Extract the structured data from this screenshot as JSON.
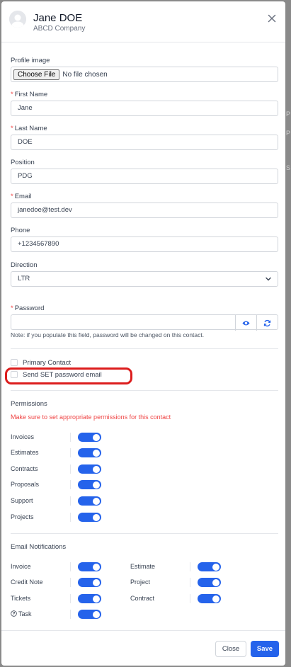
{
  "background_peek": [
    "P",
    "P",
    "S"
  ],
  "header": {
    "name": "Jane DOE",
    "company": "ABCD Company"
  },
  "form": {
    "profile_image": {
      "label": "Profile image",
      "button": "Choose File",
      "status": "No file chosen"
    },
    "first_name": {
      "label": "First Name",
      "value": "Jane",
      "required_mark": "*"
    },
    "last_name": {
      "label": "Last Name",
      "value": "DOE",
      "required_mark": "*"
    },
    "position": {
      "label": "Position",
      "value": "PDG"
    },
    "email": {
      "label": "Email",
      "value": "janedoe@test.dev",
      "required_mark": "*"
    },
    "phone": {
      "label": "Phone",
      "value": "+1234567890"
    },
    "direction": {
      "label": "Direction",
      "value": "LTR"
    },
    "password": {
      "label": "Password",
      "value": "",
      "required_mark": "*",
      "note": "Note: if you populate this field, password will be changed on this contact."
    },
    "primary_contact": {
      "label": "Primary Contact",
      "checked": false
    },
    "send_set_password": {
      "label": "Send SET password email",
      "checked": false
    }
  },
  "permissions": {
    "title": "Permissions",
    "warning": "Make sure to set appropriate permissions for this contact",
    "items": [
      {
        "label": "Invoices",
        "enabled": true
      },
      {
        "label": "Estimates",
        "enabled": true
      },
      {
        "label": "Contracts",
        "enabled": true
      },
      {
        "label": "Proposals",
        "enabled": true
      },
      {
        "label": "Support",
        "enabled": true
      },
      {
        "label": "Projects",
        "enabled": true
      }
    ]
  },
  "notifications": {
    "title": "Email Notifications",
    "left": [
      {
        "label": "Invoice",
        "enabled": true
      },
      {
        "label": "Credit Note",
        "enabled": true
      },
      {
        "label": "Tickets",
        "enabled": true
      },
      {
        "label": "Task",
        "enabled": true
      }
    ],
    "right": [
      {
        "label": "Estimate",
        "enabled": true
      },
      {
        "label": "Project",
        "enabled": true
      },
      {
        "label": "Contract",
        "enabled": true
      }
    ]
  },
  "footer": {
    "close_label": "Close",
    "save_label": "Save"
  },
  "colors": {
    "accent": "#2563eb",
    "required": "#ef4444",
    "highlight": "#dc1d1d"
  }
}
